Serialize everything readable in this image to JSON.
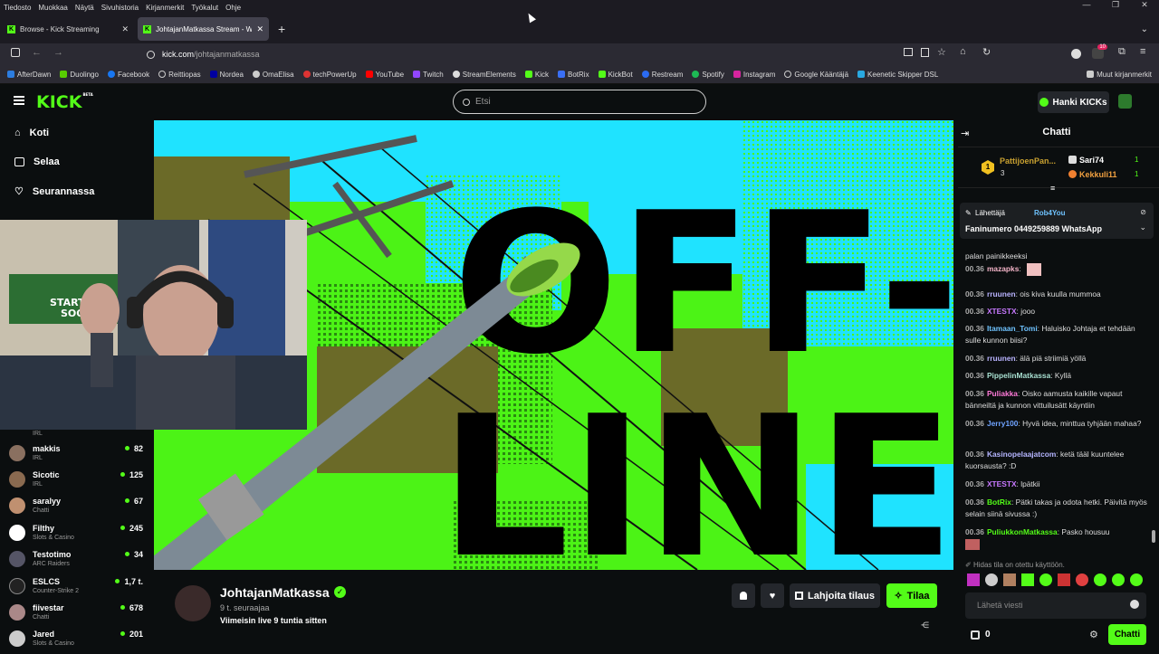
{
  "browser": {
    "menu": [
      "Tiedosto",
      "Muokkaa",
      "Näytä",
      "Sivuhistoria",
      "Kirjanmerkit",
      "Työkalut",
      "Ohje"
    ],
    "tabs": [
      {
        "title": "Browse - Kick Streaming",
        "active": false
      },
      {
        "title": "JohtajanMatkassa Stream - Wat",
        "active": true
      }
    ],
    "url_host": "kick.com",
    "url_path": "/johtajanmatkassa",
    "bookmarks": [
      "AfterDawn",
      "Duolingo",
      "Facebook",
      "Reittiopas",
      "Nordea",
      "OmaElisa",
      "techPowerUp",
      "YouTube",
      "Twitch",
      "StreamElements",
      "Kick",
      "BotRix",
      "KickBot",
      "Restream",
      "Spotify",
      "Instagram",
      "Google Kääntäjä",
      "Keenetic Skipper DSL"
    ],
    "other_bookmarks": "Muut kirjanmerkit",
    "badge_count": "10"
  },
  "kick": {
    "logo": "KICK",
    "logo_sup": "BETA",
    "search_placeholder": "Etsi",
    "get_kicks": "Hanki KICKs",
    "accent": "#53fc18"
  },
  "sidebar": {
    "nav": [
      {
        "label": "Koti",
        "icon": "home-icon"
      },
      {
        "label": "Selaa",
        "icon": "browse-icon"
      },
      {
        "label": "Seurannassa",
        "icon": "heart-icon"
      }
    ],
    "partial_category": "IRL",
    "channels": [
      {
        "name": "makkis",
        "category": "IRL",
        "viewers": "82"
      },
      {
        "name": "Sicotic",
        "category": "IRL",
        "viewers": "125"
      },
      {
        "name": "saralyy",
        "category": "Chatti",
        "viewers": "67"
      },
      {
        "name": "Filthy",
        "category": "Slots & Casino",
        "viewers": "245"
      },
      {
        "name": "Testotimo",
        "category": "ARC Raiders",
        "viewers": "34"
      },
      {
        "name": "ESLCS",
        "category": "Counter-Strike 2",
        "viewers": "1,7 t."
      },
      {
        "name": "fiivestar",
        "category": "Chatti",
        "viewers": "678"
      },
      {
        "name": "Jared",
        "category": "Slots & Casino",
        "viewers": "201"
      }
    ]
  },
  "player": {
    "offline_line1": "OFF-",
    "offline_line2": "LINE"
  },
  "webcam": {
    "poster_text1": "STARTING",
    "poster_text2": "SOON"
  },
  "stream": {
    "channel": "JohtajanMatkassa",
    "followers": "9 t. seuraajaa",
    "last_live": "Viimeisin live 9 tuntia sitten",
    "gift_label": "Lahjoita tilaus",
    "subscribe_label": "Tilaa"
  },
  "chat": {
    "title": "Chatti",
    "gifters": [
      {
        "name": "PattijoenPan...",
        "count": "3",
        "rank": "1"
      },
      {
        "name": "Sari74",
        "count": "1"
      },
      {
        "name": "Kekkuli11",
        "count": "1"
      }
    ],
    "pinned": {
      "prefix": "Lähettäjä",
      "user": "Rob4You",
      "text": "Faninumero 0449259889 WhatsApp"
    },
    "partial_text": "palan painikkeeksi",
    "messages": [
      {
        "time": "00.36",
        "user": "mazapks",
        "color": "#f5b5c9",
        "text": ""
      },
      {
        "time": "00.36",
        "user": "rruunen",
        "color": "#b9b3ff",
        "text": "ois kiva kuulla mummoa"
      },
      {
        "time": "00.36",
        "user": "XTESTX",
        "color": "#c778ff",
        "text": "jooo"
      },
      {
        "time": "00.36",
        "user": "Itamaan_Tomi",
        "color": "#6fc3ff",
        "text": "Haluisko Johtaja et tehdään sulle kunnon biisi?"
      },
      {
        "time": "00.36",
        "user": "rruunen",
        "color": "#b9b3ff",
        "text": "älä piä striimiä yöllä"
      },
      {
        "time": "00.36",
        "user": "PippelinMatkassa",
        "color": "#a8e0d1",
        "text": "Kyllä"
      },
      {
        "time": "00.36",
        "user": "Puliakka",
        "color": "#ff7ad8",
        "text": "Oisko aamusta kaikille vapaut bänneiltä ja kunnon vittuilusätt käyntiin"
      },
      {
        "time": "00.36",
        "user": "Jerry100",
        "color": "#6fa3ff",
        "text": "Hyvä idea, minttua tyhjään mahaa?"
      },
      {
        "time": "00.36",
        "user": "Kasinopelaajatcom",
        "color": "#b5b5ff",
        "text": "ketä tääl kuuntelee kuorsausta? :D"
      },
      {
        "time": "00.36",
        "user": "XTESTX",
        "color": "#c778ff",
        "text": "lpätkii"
      },
      {
        "time": "00.36",
        "user": "BotRix",
        "color": "#53fc18",
        "text": "Pätki takas ja odota hetki. Päivitä myös selain siinä sivussa :)"
      },
      {
        "time": "00.36",
        "user": "PuliukkonMatkassa",
        "color": "#53fc18",
        "text": "Pasko housuu"
      }
    ],
    "slow_mode": "Hidas tila on otettu käyttöön.",
    "input_placeholder": "Lähetä viesti",
    "points": "0",
    "send_label": "Chatti"
  }
}
